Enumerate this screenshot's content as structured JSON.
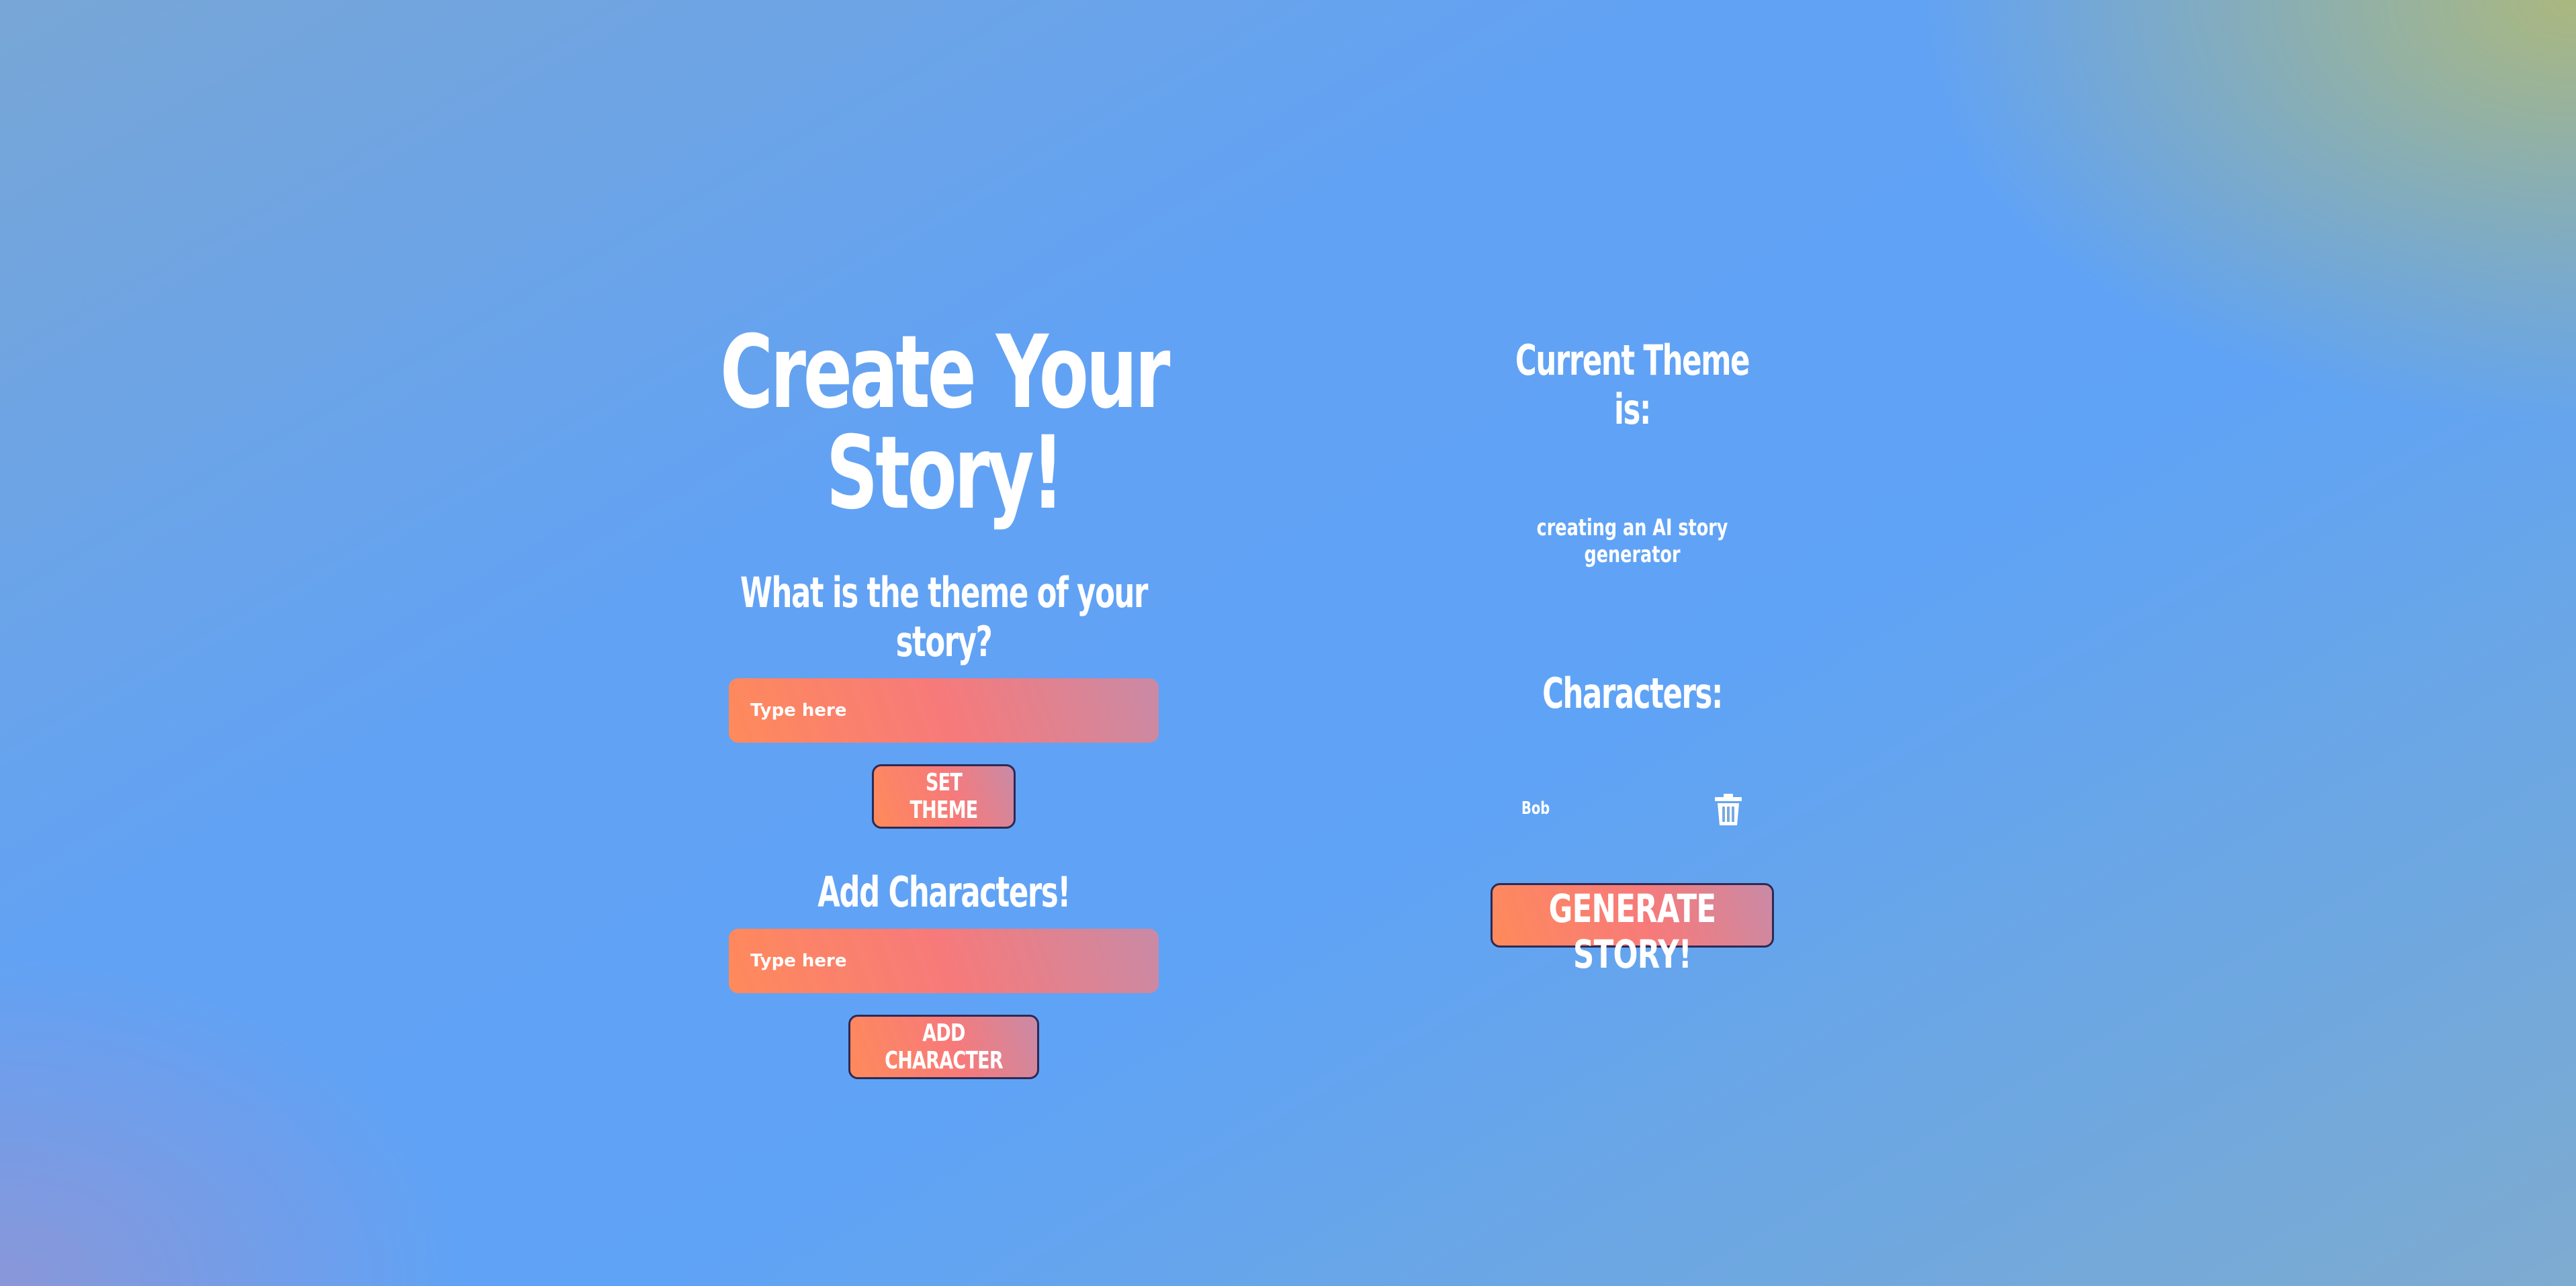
{
  "create": {
    "title": "Create Your Story!",
    "theme_prompt": "What is the theme of your story?",
    "theme_input_placeholder": "Type here",
    "set_theme_label": "SET THEME",
    "characters_prompt": "Add Characters!",
    "character_input_placeholder": "Type here",
    "add_character_label": "ADD CHARACTER"
  },
  "summary": {
    "theme_heading": "Current Theme is:",
    "theme_value": "creating an AI story generator",
    "characters_heading": "Characters:",
    "characters": [
      {
        "name": "Bob",
        "delete_icon": "trash-icon"
      }
    ],
    "generate_label": "GENERATE STORY!"
  },
  "colors": {
    "button_gradient_start": "#ff8a5b",
    "button_gradient_end": "#c98aa6",
    "button_border": "#2d2a55",
    "background_main": "#5fa3f6",
    "text": "#ffffff"
  }
}
